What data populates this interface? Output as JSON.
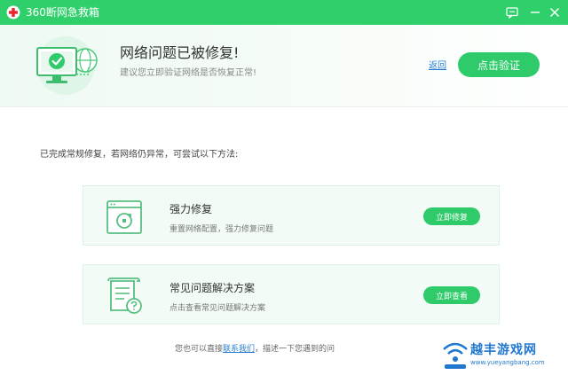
{
  "window": {
    "title": "360断网急救箱"
  },
  "header": {
    "title": "网络问题已被修复!",
    "subtitle": "建议您立即验证网络是否恢复正常!",
    "back_label": "返回",
    "verify_label": "点击验证"
  },
  "body": {
    "instructions": "已完成常规修复，若网络仍异常，可尝试以下方法:",
    "options": [
      {
        "title": "强力修复",
        "description": "重置网络配置，强力修复问题",
        "button": "立即修复",
        "icon": "window-refresh-icon"
      },
      {
        "title": "常见问题解决方案",
        "description": "点击查看常见问题解决方案",
        "button": "立即查看",
        "icon": "document-question-icon"
      }
    ]
  },
  "footer": {
    "prefix": "您也可以直接",
    "link": "联系我们",
    "suffix": "，描述一下您遇到的问"
  },
  "watermark": {
    "text": "越丰游戏网",
    "url": "www.yueyangbang.com"
  },
  "colors": {
    "brand_green": "#2fd06b",
    "button_green": "#2fcb6a",
    "link_blue": "#2a7fd4",
    "card_bg": "#f3fbf6"
  }
}
